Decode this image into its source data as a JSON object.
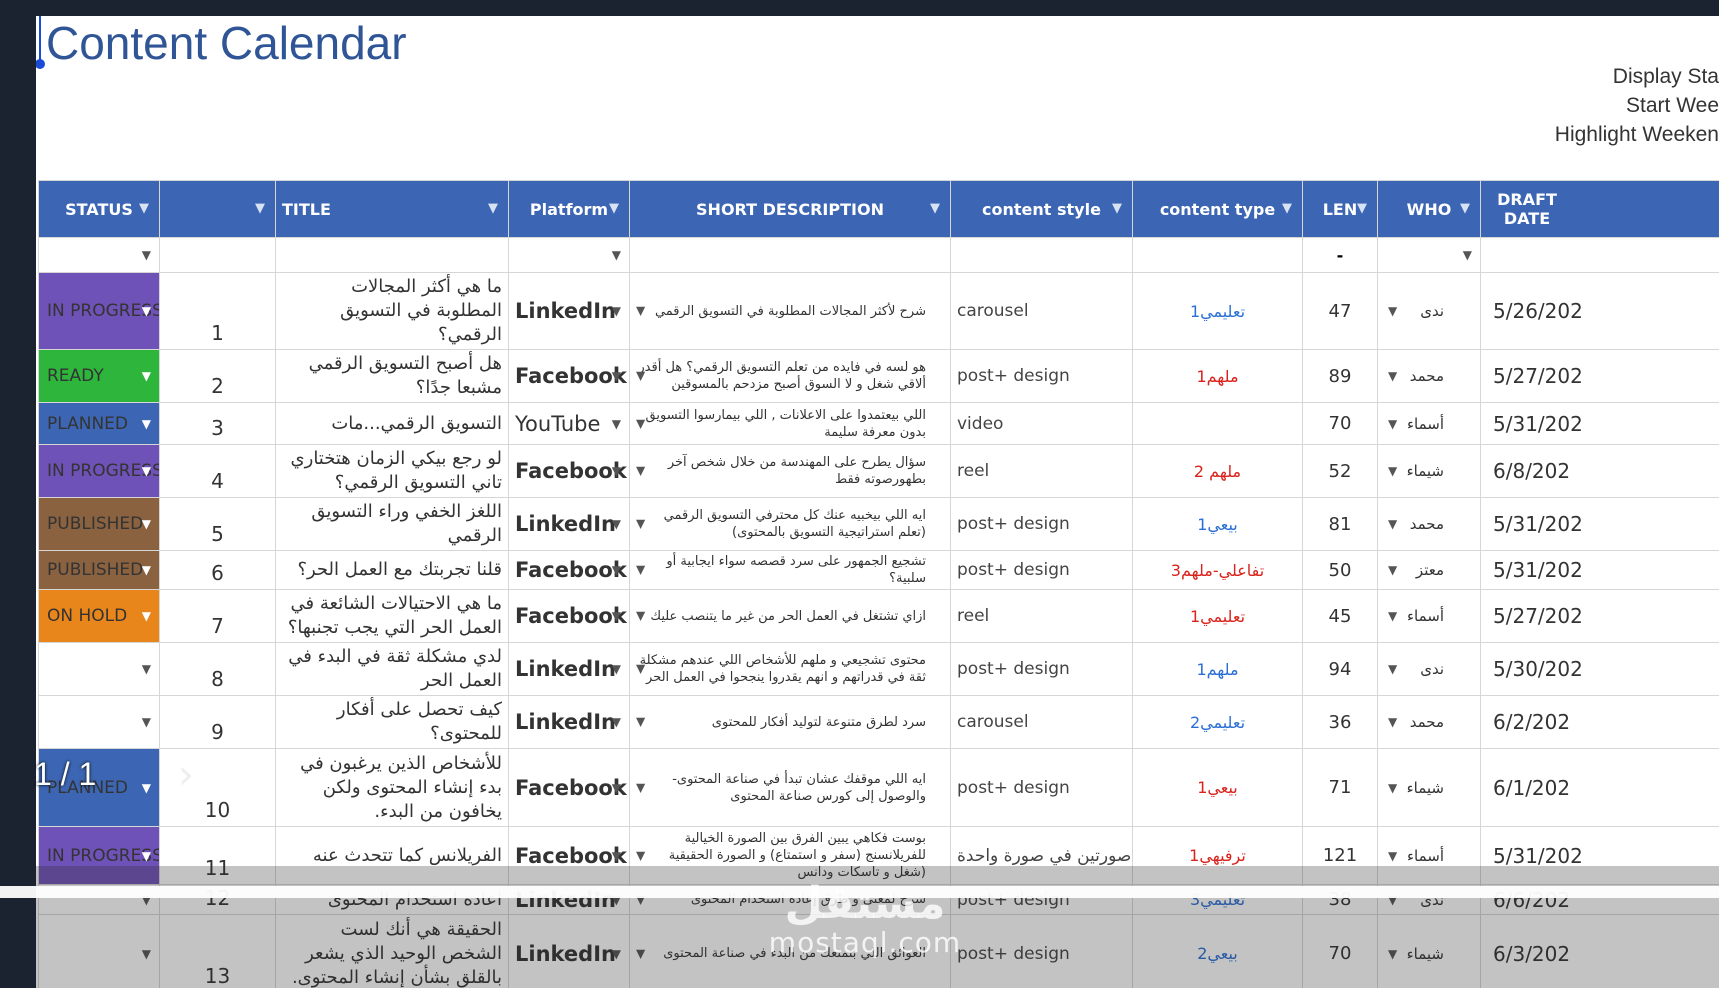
{
  "document": {
    "title": "Content Calendar",
    "settings": [
      "Display Sta",
      "Start Wee",
      "Highlight Weeken"
    ]
  },
  "columns": [
    "STATUS",
    "TITLE",
    "Platform",
    "SHORT DESCRIPTION",
    "content style",
    "content type",
    "LEN",
    "WHO",
    "DRAFT DATE"
  ],
  "filter_row": {
    "len": "-"
  },
  "status_colors": {
    "IN PROGRESS": "#6f52b8",
    "READY": "#2db53c",
    "PLANNED": "#3c66b3",
    "PUBLISHED": "#8a6240",
    "ON HOLD": "#e9861b",
    "": "#ffffff"
  },
  "rows": [
    {
      "status": "IN PROGRESS",
      "num": "1",
      "title": "ما هي أكثر المجالات المطلوبة في التسويق الرقمي؟",
      "platform": "LinkedIn",
      "desc": "شرح لأكثر المجالات المطلوبة في التسويق الرقمي",
      "style": "carousel",
      "ctype": "تعليمي1",
      "ctype_color": "blue",
      "len": "47",
      "who": "ندى",
      "date": "5/26/202"
    },
    {
      "status": "READY",
      "num": "2",
      "title": "هل أصبح التسويق الرقمي مشبعا جدًا؟",
      "platform": "Facebook",
      "desc": "هو لسه في فايده من تعلم التسويق الرقمي؟ هل أقدر ألاقي شغل و لا السوق أصبح مزدحم بالمسوقين",
      "style": "post+ design",
      "ctype": "ملهم1",
      "ctype_color": "red",
      "len": "89",
      "who": "محمد",
      "date": "5/27/202"
    },
    {
      "status": "PLANNED",
      "num": "3",
      "title": "التسويق الرقمي...مات",
      "platform": "YouTube",
      "desc": "اللي بيعتمدوا على الاعلانات , اللي بيمارسوا التسويق بدون معرفة سليمة",
      "style": "video",
      "ctype": "",
      "ctype_color": "blue",
      "len": "70",
      "who": "أسماء",
      "date": "5/31/202"
    },
    {
      "status": "IN PROGRESS",
      "num": "4",
      "title": "لو رجع بيكي الزمان هتختاري تاني التسويق الرقمي؟",
      "platform": "Facebook",
      "desc": "سؤال يطرح على المهندسة من خلال شخص آخر بطهورصوته فقط",
      "style": "reel",
      "ctype": "ملهم 2",
      "ctype_color": "red",
      "len": "52",
      "who": "شيماء",
      "date": "6/8/202"
    },
    {
      "status": "PUBLISHED",
      "num": "5",
      "title": "اللغز الخفي وراء التسويق الرقمي",
      "platform": "LinkedIn",
      "desc": "ايه اللي بيخبيه عنك كل محترفي التسويق الرقمي (تعلم استراتيجية التسويق بالمحتوى)",
      "style": "post+ design",
      "ctype": "بيعي1",
      "ctype_color": "blue",
      "len": "81",
      "who": "محمد",
      "date": "5/31/202"
    },
    {
      "status": "PUBLISHED",
      "num": "6",
      "title": "قلنا تجربتك مع العمل الحر؟",
      "platform": "Facebook",
      "desc": "تشجيع الجمهور على سرد قصصه سواء ايجابية أو سلبية؟",
      "style": "post+ design",
      "ctype": "تفاعلي-ملهم3",
      "ctype_color": "red",
      "len": "50",
      "who": "معتز",
      "date": "5/31/202"
    },
    {
      "status": "ON HOLD",
      "num": "7",
      "title": "ما هي الاحتيالات الشائعة في العمل الحر التي يجب تجنبها؟",
      "platform": "Facebook",
      "desc": "ازاي تشتغل في العمل الحر من غير ما يتنصب عليك",
      "style": "reel",
      "ctype": "تعليمي1",
      "ctype_color": "red",
      "len": "45",
      "who": "أسماء",
      "date": "5/27/202"
    },
    {
      "status": "",
      "num": "8",
      "title": "لدي مشكلة ثقة في البدء في العمل الحر",
      "platform": "LinkedIn",
      "desc": "محتوى تشجيعي و ملهم للأشخاص اللي عندهم مشكلة ثقة في قدراتهم و انهم يقدروا ينجحوا في العمل الحر",
      "style": "post+ design",
      "ctype": "ملهم1",
      "ctype_color": "blue",
      "len": "94",
      "who": "ندى",
      "date": "5/30/202"
    },
    {
      "status": "",
      "num": "9",
      "title": "كيف تحصل على أفكار للمحتوى؟",
      "platform": "LinkedIn",
      "desc": "سرد لطرق متنوعة لتوليد أفكار للمحتوى",
      "style": "carousel",
      "ctype": "تعليمي2",
      "ctype_color": "blue",
      "len": "36",
      "who": "محمد",
      "date": "6/2/202"
    },
    {
      "status": "PLANNED",
      "num": "10",
      "title": "للأشخاص الذين يرغبون في بدء إنشاء المحتوى ولكن يخافون من البدء.",
      "platform": "Facebook",
      "desc": "ايه اللي موقفك عشان تبدأ في صناعة المحتوى-والوصول إلى كورس صناعة المحتوى",
      "style": "post+ design",
      "ctype": "بيعي1",
      "ctype_color": "red",
      "len": "71",
      "who": "شيماء",
      "date": "6/1/202"
    },
    {
      "status": "IN PROGRESS",
      "num": "11",
      "title": "الفريلانس كما تتحدث عنه",
      "platform": "Facebook",
      "desc": "بوست فكاهي يبين الفرق بين الصورة الخيالية للفريلانسنج (سفر و استمتاع) و الصورة الحقيقية (شغل و تاسكات ودانس",
      "style": "صورتين في صورة واحدة",
      "ctype": "ترفيهي1",
      "ctype_color": "red",
      "len": "121",
      "who": "أسماء",
      "date": "5/31/202"
    },
    {
      "status": "",
      "num": "12",
      "title": "اعادة استخدام المحتوى",
      "platform": "LinkedIn",
      "desc": "شرح لمعنى و طرق إعادة استخدام المحتوى",
      "style": "post+ design",
      "ctype": "تعليمي3",
      "ctype_color": "blue",
      "len": "38",
      "who": "ندى",
      "date": "6/6/202"
    },
    {
      "status": "",
      "num": "13",
      "title": "الحقيقة هي أنك لست الشخص الوحيد الذي يشعر بالقلق بشأن إنشاء المحتوى.",
      "platform": "LinkedIn",
      "desc": "العوائق اللي بتمنعك من البدء في صناعة المحتوى",
      "style": "post+ design",
      "ctype": "بيعي2",
      "ctype_color": "blue",
      "len": "70",
      "who": "شيماء",
      "date": "6/3/202"
    }
  ],
  "pager": {
    "text": "1 / 1"
  },
  "watermark": {
    "arabic": "مستقل",
    "latin": "mostaql.com"
  }
}
